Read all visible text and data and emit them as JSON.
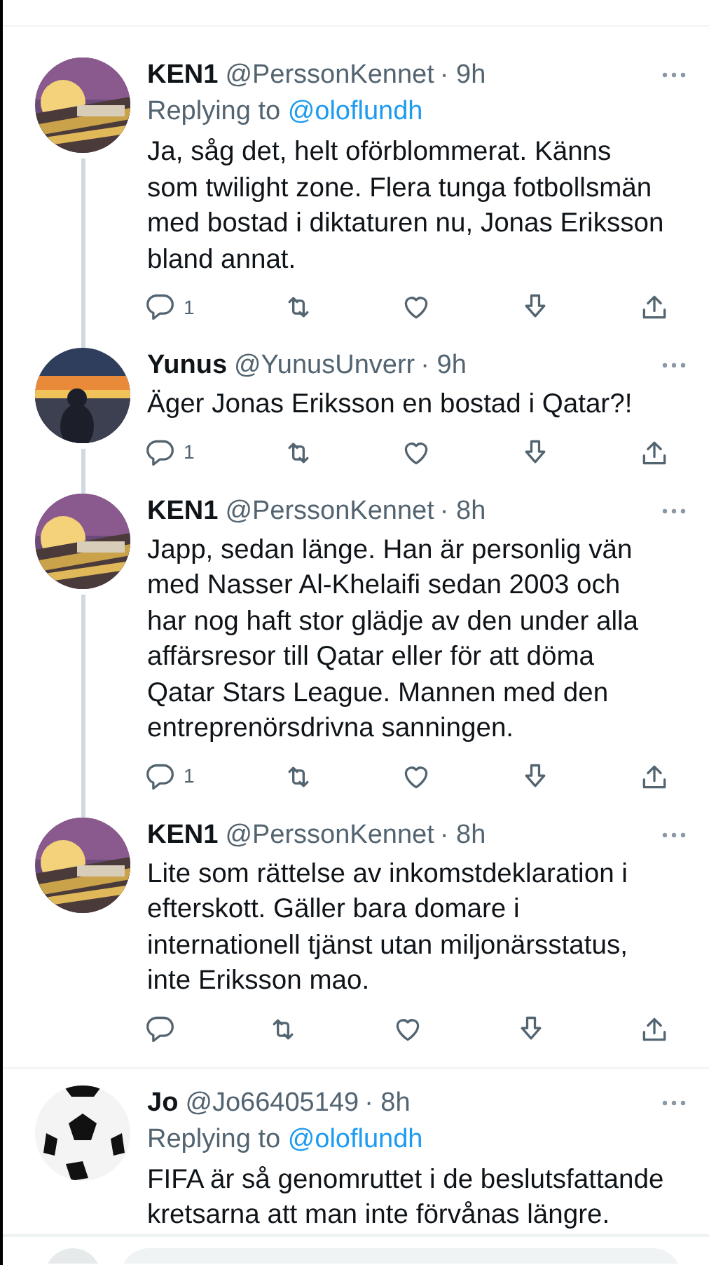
{
  "tweets": [
    {
      "name": "KEN1",
      "handle": "@PerssonKennet",
      "time": "· 9h",
      "replying_to": {
        "label": "Replying to",
        "user": "@oloflundh"
      },
      "text": "Ja, såg det, helt oförblommerat. Känns som twilight zone. Flera tunga fotbollsmän med bostad i diktaturen nu, Jonas Eriksson bland annat.",
      "reply_count": "1",
      "threaded": true
    },
    {
      "name": "Yunus",
      "handle": "@YunusUnverr",
      "time": "· 9h",
      "text": "Äger Jonas Eriksson en bostad i Qatar?!",
      "reply_count": "1",
      "threaded": true
    },
    {
      "name": "KEN1",
      "handle": "@PerssonKennet",
      "time": "· 8h",
      "text": "Japp, sedan länge. Han är personlig vän med Nasser Al-Khelaifi sedan 2003 och har nog haft stor glädje av den under alla affärsresor till Qatar eller för att döma Qatar Stars League. Mannen med den entreprenörsdrivna sanningen.",
      "reply_count": "1",
      "threaded": true
    },
    {
      "name": "KEN1",
      "handle": "@PerssonKennet",
      "time": "· 8h",
      "text": "Lite som rättelse av inkomstdeklaration i efterskott. Gäller bara domare i internationell tjänst utan miljonärsstatus, inte Eriksson mao.",
      "threaded": false
    },
    {
      "name": "Jo",
      "handle": "@Jo66405149",
      "time": "· 8h",
      "replying_to": {
        "label": "Replying to",
        "user": "@oloflundh"
      },
      "text": "FIFA är så genomruttet i de beslutsfattande kretsarna att man inte förvånas längre.",
      "threaded": false
    }
  ]
}
